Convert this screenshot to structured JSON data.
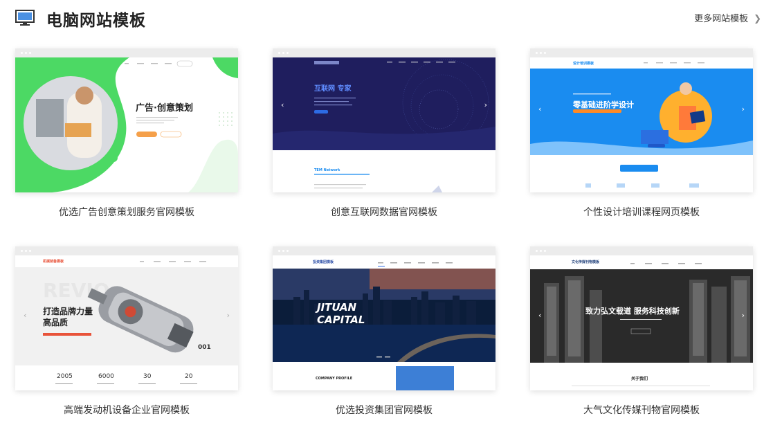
{
  "header": {
    "title": "电脑网站模板",
    "more_label": "更多网站模板",
    "icon": "monitor-icon"
  },
  "templates": [
    {
      "caption": "优选广告创意策划服务官网模板",
      "hero_title": "广告·创意策划",
      "accent": "#4cd964"
    },
    {
      "caption": "创意互联网数据官网模板",
      "hero_title": "互联网 专家",
      "section_title": "TEM Network",
      "accent": "#1f1e5e"
    },
    {
      "caption": "个性设计培训课程网页模板",
      "hero_title": "零基础进阶学设计",
      "logo": "设计培训模板",
      "accent": "#1a8cf0"
    },
    {
      "caption": "高端发动机设备企业官网模板",
      "hero_title": "打造品牌力量",
      "hero_title2": "高品质",
      "logo": "机械装备模板",
      "badge": "001",
      "stats": [
        "2005",
        "6000",
        "30",
        "20"
      ],
      "accent": "#e8533a"
    },
    {
      "caption": "优选投资集团官网模板",
      "hero_title": "JITUAN",
      "hero_title2": "CAPITAL",
      "section_title": "COMPANY PROFILE",
      "logo": "投资集团模板",
      "accent": "#0b1d3a"
    },
    {
      "caption": "大气文化传媒刊物官网模板",
      "hero_title": "致力弘文载道 服务科技创新",
      "section_title": "关于我们",
      "logo": "文化传媒刊物模板",
      "accent": "#2a2a2a"
    }
  ]
}
